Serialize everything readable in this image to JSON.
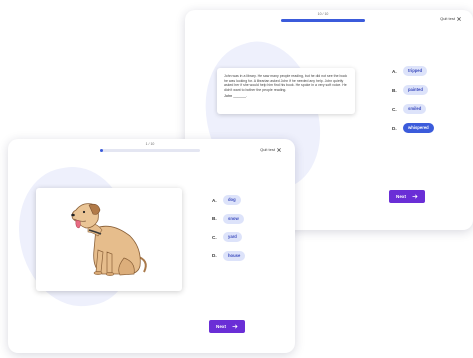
{
  "back_card": {
    "progress_text": "10 / 10",
    "quit_label": "Quit test",
    "passage": {
      "text": "John was in a library. He saw many people reading, but he did not see the book he was looking for. A librarian asked John if he needed any help. John quietly asked her if she would help him find his book. He spoke in a very soft voice. He didn't want to bother the people reading.",
      "blank_line": "John ______."
    },
    "options": [
      {
        "letter": "A.",
        "label": "tripped"
      },
      {
        "letter": "B.",
        "label": "painted"
      },
      {
        "letter": "C.",
        "label": "smiled"
      },
      {
        "letter": "D.",
        "label": "whispered"
      }
    ],
    "next_label": "Next",
    "colors": {
      "accent": "#3b5bdb",
      "button": "#6a2ed6",
      "pill": "#dde3fa"
    }
  },
  "front_card": {
    "progress_text": "1 / 10",
    "quit_label": "Quit test",
    "image_subject": "dog-illustration",
    "options": [
      {
        "letter": "A.",
        "label": "dog"
      },
      {
        "letter": "B.",
        "label": "snow"
      },
      {
        "letter": "C.",
        "label": "yard"
      },
      {
        "letter": "D.",
        "label": "house"
      }
    ],
    "next_label": "Next"
  }
}
